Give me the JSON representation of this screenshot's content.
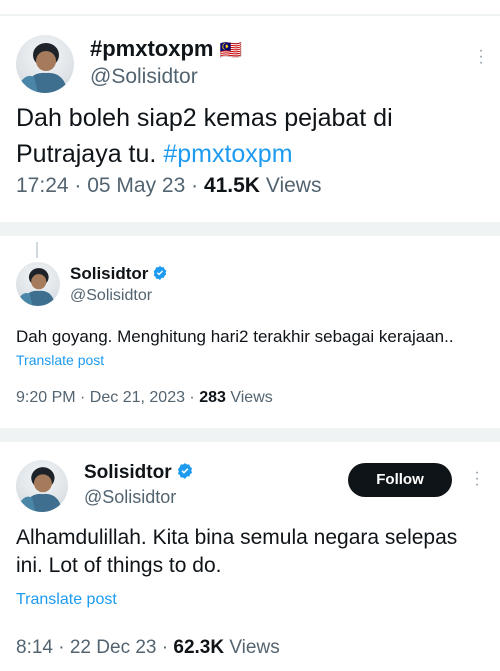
{
  "tweet1": {
    "display_name": "#pmxtoxpm",
    "flag": "🇲🇾",
    "handle": "@Solisidtor",
    "text_line1": "Dah boleh siap2 kemas pejabat di",
    "text_line2_prefix": "Putrajaya tu. ",
    "hashtag": "#pmxtoxpm",
    "time": "17:24 · 05 May 23 · ",
    "views_count": "41.5K",
    "views_label": " Views"
  },
  "tweet2": {
    "display_name": "Solisidtor",
    "handle": "@Solisidtor",
    "text": "Dah goyang. Menghitung hari2 terakhir sebagai kerajaan..",
    "translate": "Translate post",
    "time": "9:20 PM · Dec 21, 2023 · ",
    "views_count": "283",
    "views_label": " Views"
  },
  "tweet3": {
    "display_name": "Solisidtor",
    "handle": "@Solisidtor",
    "follow_label": "Follow",
    "text_line1": "Alhamdulillah. Kita bina semula negara selepas",
    "text_line2": "ini. Lot of things to do.",
    "translate": "Translate post",
    "time": "8:14 · 22 Dec 23 · ",
    "views_count": "62.3K",
    "views_label": " Views"
  },
  "colors": {
    "accent": "#1d9bf0",
    "text": "#0f1419",
    "secondary": "#536471",
    "follow_bg": "#0f1419"
  },
  "icons": [
    "verified-badge-icon",
    "more-options-icon",
    "malaysia-flag-icon"
  ]
}
